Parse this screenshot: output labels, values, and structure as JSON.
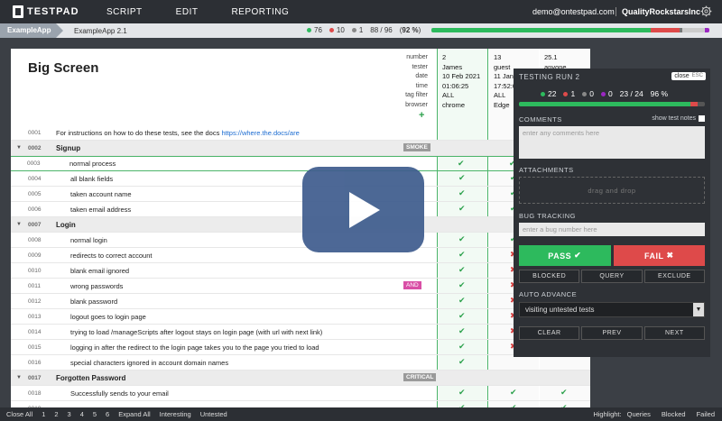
{
  "topbar": {
    "logo": "TESTPAD",
    "nav": [
      "SCRIPT",
      "EDIT",
      "REPORTING"
    ],
    "email": "demo@ontestpad.com",
    "org": "QualityRockstarsInc"
  },
  "crumbs": {
    "project": "ExampleApp",
    "folder": "ExampleApp 2.1"
  },
  "stats": {
    "pass": "76",
    "fail": "10",
    "other": "1",
    "progress": "88 / 96",
    "percent": "92 %",
    "pass_frac": 0.79,
    "fail_frac": 0.104,
    "other_frac": 0.01
  },
  "page": {
    "title": "Big Screen"
  },
  "meta_labels": [
    "number",
    "tester",
    "date",
    "time",
    "tag filter",
    "browser"
  ],
  "runs": [
    {
      "number": "2",
      "tester": "James",
      "date": "10 Feb 2021",
      "time": "01:06:25",
      "tag": "ALL",
      "browser": "chrome"
    },
    {
      "number": "13",
      "tester": "guest",
      "date": "11 Jan",
      "time": "17:52:0",
      "tag": "ALL",
      "browser": "Edge"
    },
    {
      "number": "25.1",
      "tester": "anyone",
      "date": "",
      "time": "",
      "tag": "",
      "browser": ""
    }
  ],
  "rows": [
    {
      "num": "0001",
      "title": "For instructions on how to do these tests, see the docs ",
      "link": "https://where.the.docs/are",
      "type": "note"
    },
    {
      "num": "0002",
      "title": "Signup",
      "type": "group",
      "tag": "SMOKE"
    },
    {
      "num": "0003",
      "title": "normal process",
      "type": "test",
      "selected": true,
      "c1": "✔",
      "c2": "✔",
      "c3": ""
    },
    {
      "num": "0004",
      "title": "all blank fields",
      "type": "test",
      "c1": "✔",
      "c2": "✔",
      "c3": ""
    },
    {
      "num": "0005",
      "title": "taken account name",
      "type": "test",
      "c1": "✔",
      "c2": "✔",
      "c3": ""
    },
    {
      "num": "0006",
      "title": "taken email address",
      "type": "test",
      "c1": "✔",
      "c2": "✔",
      "c3": ""
    },
    {
      "num": "0007",
      "title": "Login",
      "type": "group",
      "tag": ""
    },
    {
      "num": "0008",
      "title": "normal login",
      "type": "test",
      "c1": "✔",
      "c2": "✔",
      "c3": ""
    },
    {
      "num": "0009",
      "title": "redirects to correct account",
      "type": "test",
      "c1": "✔",
      "c2": "✖",
      "c3": ""
    },
    {
      "num": "0010",
      "title": "blank email ignored",
      "type": "test",
      "c1": "✔",
      "c2": "✖",
      "c3": ""
    },
    {
      "num": "0011",
      "title": "wrong passwords",
      "type": "test",
      "tag": "AND",
      "c1": "✔",
      "c2": "✖",
      "c3": ""
    },
    {
      "num": "0012",
      "title": "blank password",
      "type": "test",
      "c1": "✔",
      "c2": "✖",
      "c3": ""
    },
    {
      "num": "0013",
      "title": "logout goes to login page",
      "type": "test",
      "c1": "✔",
      "c2": "✖",
      "c3": ""
    },
    {
      "num": "0014",
      "title": "trying to load /manageScripts after logout stays on login page (with url with next link)",
      "type": "test",
      "c1": "✔",
      "c2": "✖",
      "c3": ""
    },
    {
      "num": "0015",
      "title": "logging in after the redirect to the login page takes you to the page you tried to load",
      "type": "test",
      "c1": "✔",
      "c2": "✖",
      "c3": ""
    },
    {
      "num": "0016",
      "title": "special characters ignored in account domain names",
      "type": "test",
      "c1": "✔",
      "c2": "",
      "c3": ""
    },
    {
      "num": "0017",
      "title": "Forgotten Password",
      "type": "group",
      "tag": "CRITICAL"
    },
    {
      "num": "0018",
      "title": "Successfully sends to your email",
      "type": "test",
      "c1": "✔",
      "c2": "✔",
      "c3": "✔"
    },
    {
      "num": "0019",
      "title": "",
      "type": "test",
      "c1": "✔",
      "c2": "✔",
      "c3": "✔"
    }
  ],
  "panel": {
    "title": "TESTING RUN 2",
    "close": "close",
    "esc": "ESC",
    "pass": "22",
    "fail": "1",
    "other": "0",
    "query": "0",
    "progress": "23 / 24",
    "percent": "96 %",
    "pass_frac": 0.92,
    "fail_frac": 0.04,
    "comments_label": "COMMENTS",
    "show_notes": "show test notes",
    "comments_placeholder": "enter any comments here",
    "attachments_label": "ATTACHMENTS",
    "drop": "drag and drop",
    "bug_label": "BUG TRACKING",
    "bug_placeholder": "enter a bug number here",
    "pass_label": "PASS",
    "fail_label": "FAIL",
    "blocked": "BLOCKED",
    "query_btn": "QUERY",
    "exclude": "EXCLUDE",
    "auto_label": "AUTO ADVANCE",
    "auto_value": "visiting untested tests",
    "clear": "CLEAR",
    "prev": "PREV",
    "next": "NEXT"
  },
  "colors": {
    "pass": "#2dba5d",
    "fail": "#de4a4a",
    "other": "#888888",
    "query": "#9b27c2"
  },
  "bottom": {
    "left": [
      "Close All",
      "1",
      "2",
      "3",
      "4",
      "5",
      "6",
      "Expand All",
      "Interesting",
      "Untested"
    ],
    "highlight": "Highlight:",
    "right": [
      "Queries",
      "Blocked",
      "Failed"
    ]
  }
}
